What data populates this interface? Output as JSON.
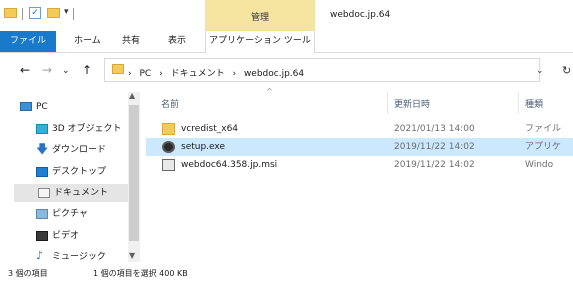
{
  "title_bar": {
    "manage_tab": "管理",
    "window_title": "webdoc.jp.64"
  },
  "ribbon": {
    "tabs": [
      "ファイル",
      "ホーム",
      "共有",
      "表示"
    ],
    "contextual_tab": "アプリケーション ツール"
  },
  "address_bar": {
    "path": [
      "PC",
      "ドキュメント",
      "webdoc.jp.64"
    ],
    "separator": "›"
  },
  "nav_pane": {
    "items": [
      {
        "label": "PC",
        "icon": "pc-icon"
      },
      {
        "label": "3D オブジェクト",
        "icon": "3d-objects-icon"
      },
      {
        "label": "ダウンロード",
        "icon": "downloads-icon"
      },
      {
        "label": "デスクトップ",
        "icon": "desktop-icon"
      },
      {
        "label": "ドキュメント",
        "icon": "documents-icon",
        "selected": true
      },
      {
        "label": "ピクチャ",
        "icon": "pictures-icon"
      },
      {
        "label": "ビデオ",
        "icon": "videos-icon"
      },
      {
        "label": "ミュージック",
        "icon": "music-icon"
      }
    ]
  },
  "file_list": {
    "columns": [
      "名前",
      "更新日時",
      "種類"
    ],
    "rows": [
      {
        "name": "vcredist_x64",
        "date": "2021/01/13 14:00",
        "type": "ファイル",
        "icon": "folder-icon"
      },
      {
        "name": "setup.exe",
        "date": "2019/11/22 14:02",
        "type": "アプリケ",
        "icon": "setup-exe-icon",
        "selected": true
      },
      {
        "name": "webdoc64.358.jp.msi",
        "date": "2019/11/22 14:02",
        "type": "Windo",
        "icon": "msi-installer-icon"
      }
    ]
  },
  "status_bar": {
    "item_count": "3 個の項目",
    "selection": "1 個の項目を選択 400 KB"
  },
  "colors": {
    "file_tab": "#1979ca",
    "manage_tab": "#f5e4a0",
    "selected_row": "#cce8ff",
    "folder": "#f3cc58"
  }
}
